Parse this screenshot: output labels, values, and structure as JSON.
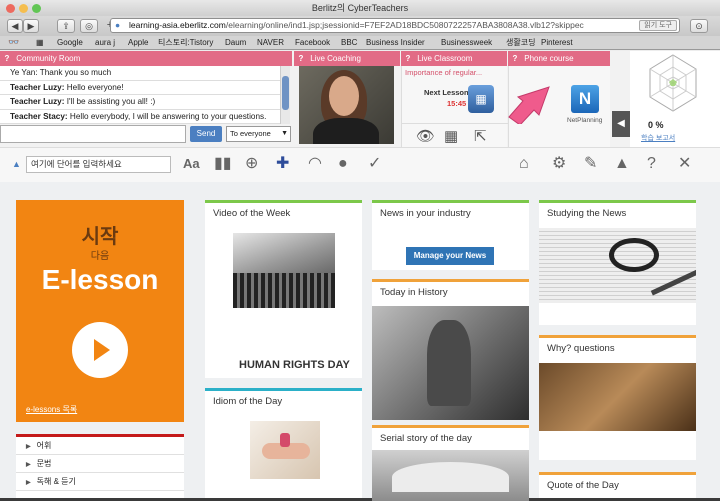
{
  "window": {
    "title": "Berlitz의 CyberTeachers"
  },
  "toolbar": {
    "url_host": "learning-asia.eberlitz.com",
    "url_path": "/elearning/online/ind1.jsp;jsessionid=F7EF2AD18BDC5080722257ABA3808A38.vlb12?skippec",
    "reader_label": "읽기 도구"
  },
  "bookmarks": [
    "Google",
    "aura j",
    "Apple",
    "티스토리:Tistory",
    "Daum",
    "NAVER",
    "Facebook",
    "BBC",
    "Business Insider",
    "Businessweek",
    "생활코딩",
    "Pinterest"
  ],
  "community": {
    "header": "Community Room",
    "messages": [
      {
        "speaker": "Ye Yan:",
        "text": " Thank you so much"
      },
      {
        "speaker": "Teacher Luzy:",
        "text": " Hello everyone!"
      },
      {
        "speaker": "Teacher Luzy:",
        "text": " I'll be assisting you all! :)"
      },
      {
        "speaker": "Teacher Stacy:",
        "text": " Hello everybody, I will be answering to your questions."
      }
    ],
    "send_label": "Send",
    "to_select": "To everyone"
  },
  "coaching": {
    "header": "Live Coaching"
  },
  "classroom": {
    "header": "Live Classroom",
    "importance": "Importance of regular...",
    "next_lesson": "Next Lesson",
    "time": "15:45"
  },
  "phone": {
    "header": "Phone course",
    "netplanning": "NetPlanning",
    "netplanning_letter": "N"
  },
  "progress": {
    "percent": "0 %",
    "report_link": "학습 보고서"
  },
  "search": {
    "placeholder": "여기에 단어를 입력하세요"
  },
  "elesson": {
    "kicker": "시작",
    "sub": "다음",
    "title": "E-lesson",
    "link": "e-lessons 목록",
    "list": [
      "어휘",
      "문법",
      "독해 & 듣기"
    ]
  },
  "cards": {
    "video_week": {
      "title": "Video of the Week",
      "caption": "HUMAN RIGHTS DAY"
    },
    "idiom": {
      "title": "Idiom of the Day"
    },
    "news": {
      "title": "News in your industry",
      "button": "Manage your News"
    },
    "history": {
      "title": "Today in History"
    },
    "serial": {
      "title": "Serial story of the day"
    },
    "studying": {
      "title": "Studying the News"
    },
    "why": {
      "title": "Why? questions"
    },
    "quote": {
      "title": "Quote of the Day"
    }
  },
  "colors": {
    "pink_header": "#e26b86",
    "orange": "#f28512",
    "blue": "#2f74b5",
    "green_rule": "#7cc84a",
    "orange_rule": "#f0a23a",
    "teal_rule": "#2bb0c8"
  }
}
